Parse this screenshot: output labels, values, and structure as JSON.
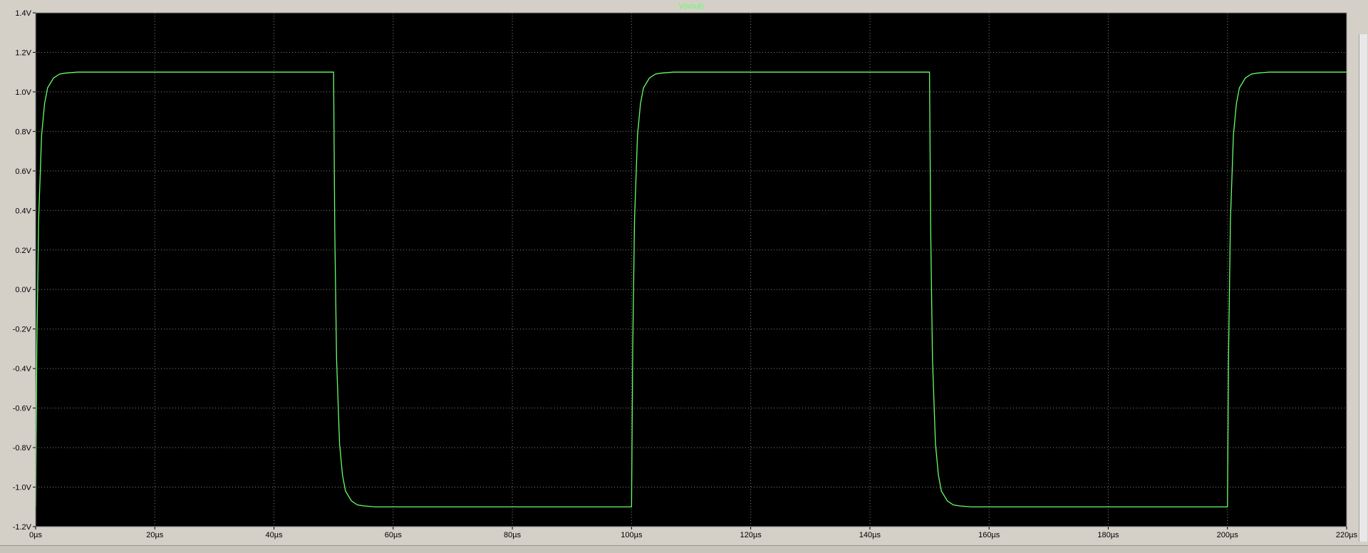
{
  "window": {
    "background": "#d4d0c8",
    "plot_background": "#000000",
    "grid_color": "#808080",
    "trace_color": "#66ff66"
  },
  "chart_data": {
    "type": "line",
    "title": "V(vout)",
    "xlabel": "",
    "ylabel": "",
    "xlim": [
      0,
      220
    ],
    "ylim": [
      -1.2,
      1.4
    ],
    "x_ticks": [
      0,
      20,
      40,
      60,
      80,
      100,
      120,
      140,
      160,
      180,
      200,
      220
    ],
    "x_tick_labels": [
      "0µs",
      "20µs",
      "40µs",
      "60µs",
      "80µs",
      "100µs",
      "120µs",
      "140µs",
      "160µs",
      "180µs",
      "200µs",
      "220µs"
    ],
    "y_ticks": [
      -1.2,
      -1.0,
      -0.8,
      -0.6,
      -0.4,
      -0.2,
      0.0,
      0.2,
      0.4,
      0.6,
      0.8,
      1.0,
      1.2,
      1.4
    ],
    "y_tick_labels": [
      "-1.2V",
      "-1.0V",
      "-0.8V",
      "-0.6V",
      "-0.4V",
      "-0.2V",
      "0.0V",
      "0.2V",
      "0.4V",
      "0.6V",
      "0.8V",
      "1.0V",
      "1.2V",
      "1.4V"
    ],
    "grid": true,
    "series": [
      {
        "name": "V(vout)",
        "color": "#66ff66",
        "x": [
          0,
          0.2,
          0.5,
          1,
          1.5,
          2,
          3,
          4,
          5,
          7,
          10,
          50,
          50.2,
          50.5,
          51,
          51.5,
          52,
          53,
          54,
          55,
          57,
          60,
          100,
          100.2,
          100.5,
          101,
          101.5,
          102,
          103,
          104,
          105,
          107,
          110,
          150,
          150.2,
          150.5,
          151,
          151.5,
          152,
          153,
          154,
          155,
          157,
          160,
          200,
          200.2,
          200.5,
          201,
          201.5,
          202,
          203,
          204,
          205,
          207,
          210,
          220
        ],
        "values": [
          -1.1,
          -0.3,
          0.35,
          0.78,
          0.94,
          1.02,
          1.07,
          1.09,
          1.095,
          1.1,
          1.1,
          1.1,
          0.3,
          -0.35,
          -0.78,
          -0.94,
          -1.02,
          -1.07,
          -1.09,
          -1.095,
          -1.1,
          -1.1,
          -1.1,
          -0.3,
          0.35,
          0.78,
          0.94,
          1.02,
          1.07,
          1.09,
          1.095,
          1.1,
          1.1,
          1.1,
          0.3,
          -0.35,
          -0.78,
          -0.94,
          -1.02,
          -1.07,
          -1.09,
          -1.095,
          -1.1,
          -1.1,
          -1.1,
          -0.3,
          0.35,
          0.78,
          0.94,
          1.02,
          1.07,
          1.09,
          1.095,
          1.1,
          1.1,
          1.1
        ]
      }
    ]
  }
}
